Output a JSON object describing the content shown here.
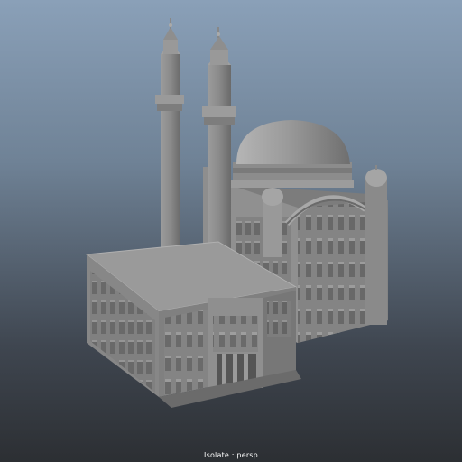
{
  "viewport": {
    "camera_label": "Isolate : persp",
    "model": "mosque-model"
  }
}
